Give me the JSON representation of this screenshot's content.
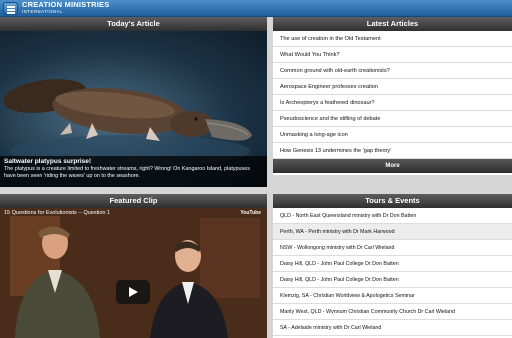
{
  "app": {
    "logo_line1": "CREATION MINISTRIES",
    "logo_line2": "INTERNATIONAL"
  },
  "today": {
    "heading": "Today's Article",
    "caption_title": "Saltwater platypus surprise!",
    "caption_text": "The platypus is a creature limited to freshwater streams, right? Wrong! On Kangaroo Island, platypuses have been seen 'riding the waves' up on to the seashore."
  },
  "latest": {
    "heading": "Latest Articles",
    "items": [
      "The use of creation in the Old Testament",
      "What Would You Think?",
      "Common ground with old-earth creationists?",
      "Aerospace Engineer professes creation",
      "Is Archeopteryx a feathered dinosaur?",
      "Pseudoscience and the stifling of debate",
      "Unmasking a long-age icon",
      "How Genesis 13 undermines the 'gap theory'"
    ],
    "more_label": "More"
  },
  "clip": {
    "heading": "Featured Clip",
    "video_title": "15 Questions for Evolutionists -- Question 1",
    "provider": "YouTube"
  },
  "tours": {
    "heading": "Tours & Events",
    "items": [
      "QLD - North East Queensland ministry with Dr Don Batten",
      "Perth, WA - Perth ministry with Dr Mark Harwood",
      "NSW - Wollongong ministry with Dr Carl Wieland",
      "Daisy Hill, QLD - John Paul College Dr Don Batten",
      "Daisy Hill, QLD - John Paul College Dr Don Batten",
      "Klemzig, SA - Christian Worldview & Apologetics Seminar",
      "Manly West, QLD - Wynnum Christian Community Church Dr Carl Wieland",
      "SA - Adelaide ministry with Dr Carl Wieland"
    ]
  },
  "colors": {
    "topbar": "#2f73b5",
    "panel_header": "#3a3a3a"
  }
}
